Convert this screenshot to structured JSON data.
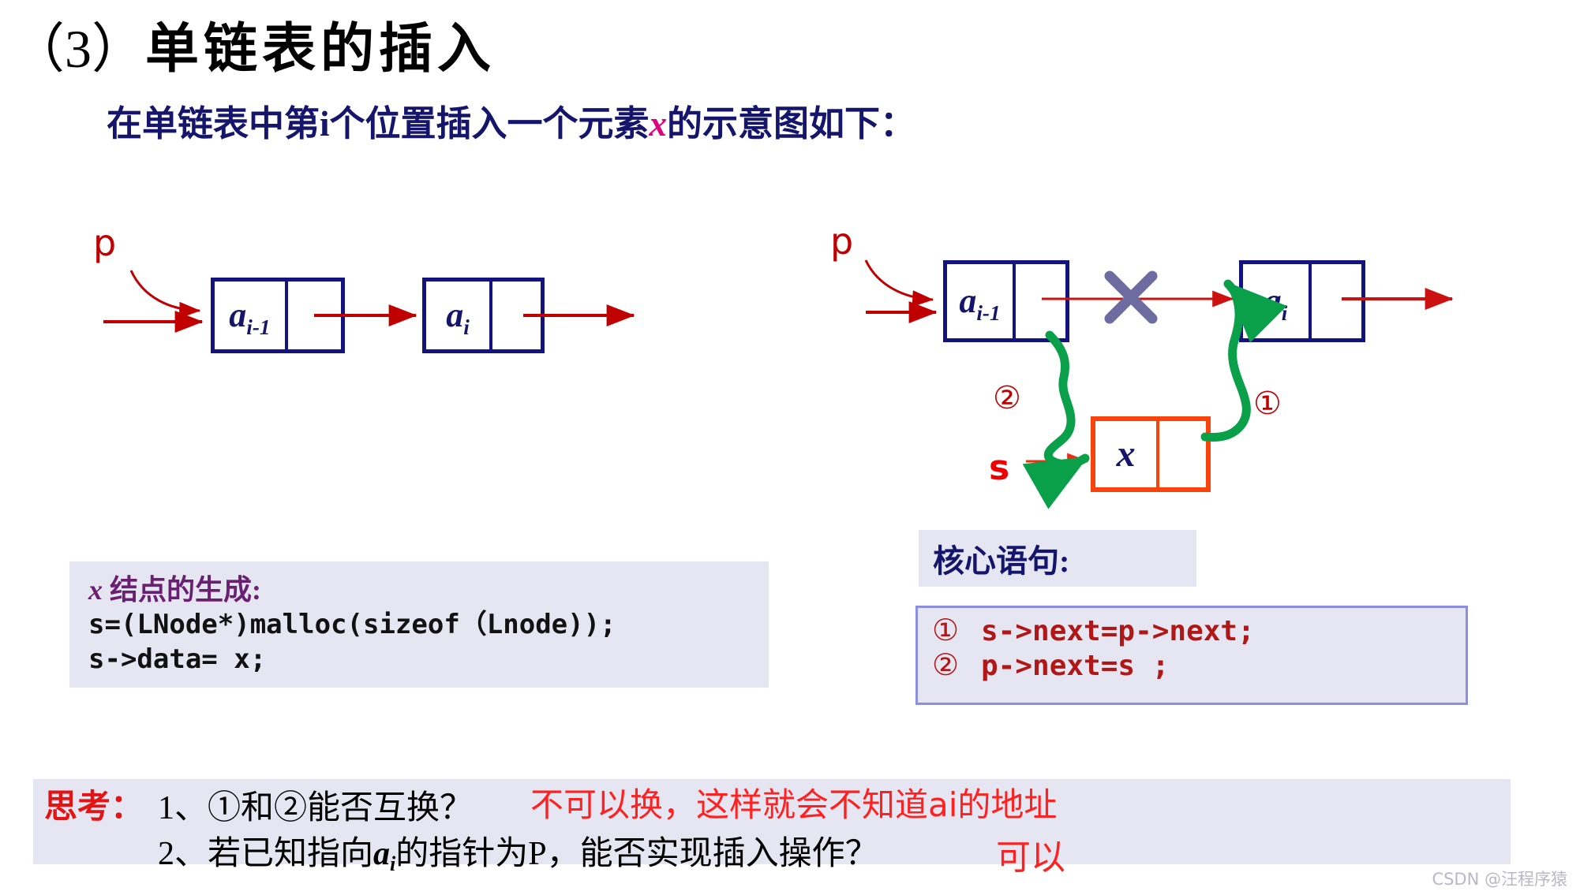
{
  "slide": {
    "title_number": "（3）",
    "title_text": "单链表的插入",
    "subtitle_prefix": "在单链表中第i个位置插入一个元素",
    "subtitle_highlight": "x",
    "subtitle_suffix": "的示意图如下："
  },
  "diagram_before": {
    "pointer_label": "p",
    "node1_data": "a",
    "node1_sub": "i-1",
    "node2_data": "a",
    "node2_sub": "i"
  },
  "diagram_after": {
    "pointer_label_p": "p",
    "pointer_label_s": "s",
    "node1_data": "a",
    "node1_sub": "i-1",
    "node2_data": "a",
    "node2_sub": "i",
    "new_node_data": "x",
    "step_mark_1": "①",
    "step_mark_2": "②",
    "broken_link_mark": "X"
  },
  "code_panel_left": {
    "heading_italic": "x",
    "heading_rest": " 结点的生成:",
    "lines": [
      "s=(LNode*)malloc(sizeof（Lnode));",
      "s->data= x;"
    ]
  },
  "core_panel": {
    "title": "核心语句:",
    "statements": [
      {
        "mark": "①",
        "code": "s->next=p->next;"
      },
      {
        "mark": "②",
        "code": "p->next=s ;"
      }
    ]
  },
  "questions": {
    "lead": "思考：",
    "q1": "1、①和②能否互换？",
    "a1": "不可以换，这样就会不知道ai的地址",
    "q2_part1": "2、若已知指向",
    "q2_italic": "a",
    "q2_italic_sub": "i",
    "q2_part2": "的指针为P，能否实现插入操作？",
    "a2": "可以"
  },
  "watermark": {
    "text": "CSDN @汪程序猿"
  },
  "colors": {
    "navy": "#131380",
    "orange": "#f8430b",
    "red_arrow": "#c00000",
    "green_curve": "#0aa04a",
    "x_mark": "#6c6ca0",
    "panel_bg": "#e6e6f2",
    "answer_red": "#ff2020"
  }
}
